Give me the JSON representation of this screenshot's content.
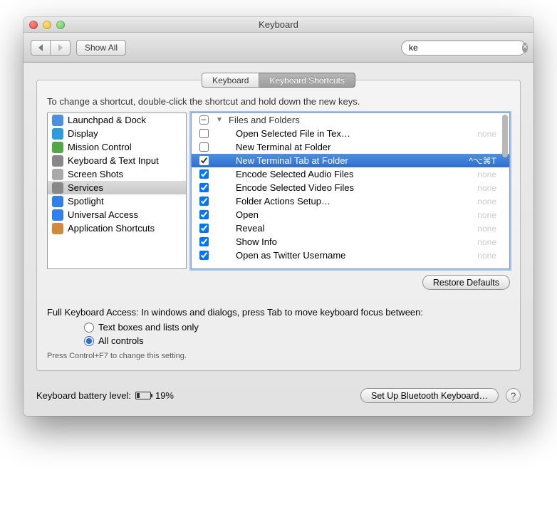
{
  "window": {
    "title": "Keyboard"
  },
  "toolbar": {
    "show_all": "Show All",
    "search_value": "ke"
  },
  "tabs": {
    "keyboard": "Keyboard",
    "shortcuts": "Keyboard Shortcuts"
  },
  "hint": "To change a shortcut, double-click the shortcut and hold down the new keys.",
  "sidebar": [
    {
      "icon": "launchpad",
      "label": "Launchpad & Dock"
    },
    {
      "icon": "display",
      "label": "Display"
    },
    {
      "icon": "mission",
      "label": "Mission Control"
    },
    {
      "icon": "keyboard",
      "label": "Keyboard & Text Input"
    },
    {
      "icon": "screen",
      "label": "Screen Shots"
    },
    {
      "icon": "services",
      "label": "Services"
    },
    {
      "icon": "spotlight",
      "label": "Spotlight"
    },
    {
      "icon": "access",
      "label": "Universal Access"
    },
    {
      "icon": "apps",
      "label": "Application Shortcuts"
    }
  ],
  "shortcuts": {
    "group": "Files and Folders",
    "items": [
      {
        "checked": false,
        "label": "Open Selected File in Tex…",
        "shortcut": "none",
        "dim": true
      },
      {
        "checked": false,
        "label": "New Terminal at Folder",
        "shortcut": ""
      },
      {
        "checked": true,
        "label": "New Terminal Tab at Folder",
        "shortcut": "^⌥⌘T",
        "selected": true
      },
      {
        "checked": true,
        "label": "Encode Selected Audio Files",
        "shortcut": "none",
        "dim": true
      },
      {
        "checked": true,
        "label": "Encode Selected Video Files",
        "shortcut": "none",
        "dim": true
      },
      {
        "checked": true,
        "label": "Folder Actions Setup…",
        "shortcut": "none",
        "dim": true
      },
      {
        "checked": true,
        "label": "Open",
        "shortcut": "none",
        "dim": true
      },
      {
        "checked": true,
        "label": "Reveal",
        "shortcut": "none",
        "dim": true
      },
      {
        "checked": true,
        "label": "Show Info",
        "shortcut": "none",
        "dim": true
      },
      {
        "checked": true,
        "label": "Open as Twitter Username",
        "shortcut": "none",
        "dim": true
      }
    ]
  },
  "restore": "Restore Defaults",
  "fka": {
    "label": "Full Keyboard Access: In windows and dialogs, press Tab to move keyboard focus between:",
    "opt1": "Text boxes and lists only",
    "opt2": "All controls",
    "note": "Press Control+F7 to change this setting."
  },
  "footer": {
    "battery_label": "Keyboard battery level:",
    "battery_pct": "19%",
    "bluetooth": "Set Up Bluetooth Keyboard…"
  }
}
